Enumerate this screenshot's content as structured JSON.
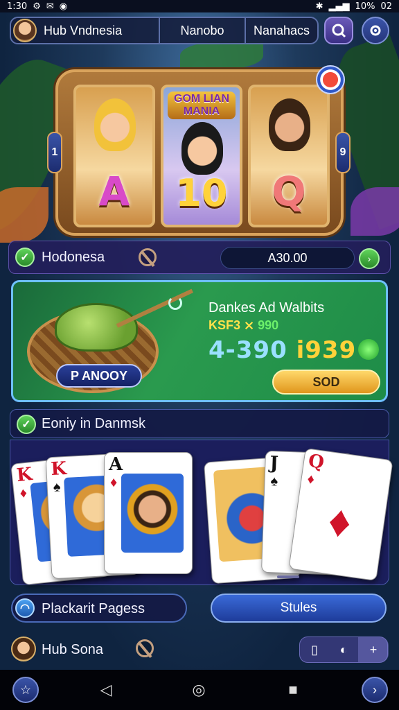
{
  "status_bar": {
    "time": "1:30",
    "battery": "10%",
    "clock_right": "02"
  },
  "top_bar": {
    "title": "Hub Vndnesia",
    "tab_middle": "Nanobo",
    "tab_right": "Nanahacs"
  },
  "slot": {
    "banner": "GOM LIAN MANIA",
    "symbols": [
      "A",
      "10",
      "Q"
    ],
    "left_tab": "1",
    "right_tab": "9"
  },
  "info_row": {
    "label": "Hodonesa",
    "amount": "A30.00",
    "arrow": "›"
  },
  "promo": {
    "pill": "P ANOOY",
    "title": "Dankes Ad Walbits",
    "sub_yellow": "KSF3 ⨯",
    "sub_green": "990",
    "big_a": "4-390",
    "big_b": "i939",
    "button": "SOD"
  },
  "section": {
    "title": "Eoniy in Danmsk"
  },
  "cards": [
    {
      "rank": "K",
      "suit": "♦",
      "color": "red"
    },
    {
      "rank": "K",
      "suit": "♠",
      "color": "red"
    },
    {
      "rank": "A",
      "suit": "♦",
      "color": "red"
    },
    {
      "rank": "",
      "suit": "",
      "color": "red"
    },
    {
      "rank": "J",
      "suit": "♠",
      "color": "black"
    },
    {
      "rank": "Q",
      "suit": "♦",
      "color": "red"
    }
  ],
  "bottom_buttons": {
    "left_label": "Plackarit Pagess",
    "right_label": "Stules"
  },
  "footer": {
    "name": "Hub Sona",
    "ctrl_plus": "+"
  },
  "nav": {
    "back": "◁",
    "home": "◎",
    "recents": "■"
  }
}
